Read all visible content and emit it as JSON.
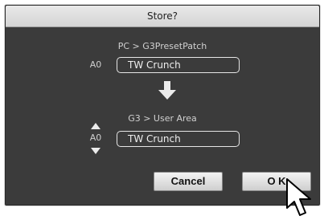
{
  "dialog": {
    "title": "Store?",
    "source": {
      "path": "PC > G3PresetPatch",
      "slot": "A0",
      "name": "TW Crunch"
    },
    "destination": {
      "path": "G3 > User Area",
      "slot": "A0",
      "name": "TW Crunch"
    },
    "buttons": {
      "cancel": "Cancel",
      "ok": "O K"
    }
  },
  "icons": {
    "transfer_arrow": "arrow-down-icon",
    "slot_up": "triangle-up-icon",
    "slot_down": "triangle-down-icon",
    "cursor": "mouse-pointer-icon"
  },
  "colors": {
    "dialog_bg": "#3b3b3b",
    "titlebar_bg": "#dcdcdc",
    "text_light": "#d0d0d0",
    "button_bg": "#e4e4e4"
  }
}
